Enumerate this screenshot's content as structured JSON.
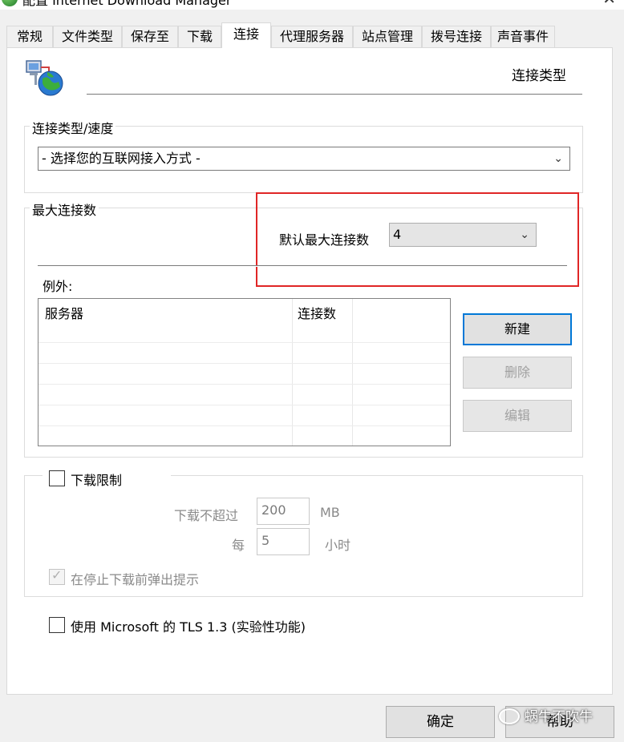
{
  "window": {
    "title": "配置 Internet Download Manager",
    "close_glyph": "✕"
  },
  "tabs": [
    {
      "label": "常规"
    },
    {
      "label": "文件类型"
    },
    {
      "label": "保存至"
    },
    {
      "label": "下载"
    },
    {
      "label": "连接",
      "active": true
    },
    {
      "label": "代理服务器"
    },
    {
      "label": "站点管理"
    },
    {
      "label": "拨号连接"
    },
    {
      "label": "声音事件"
    }
  ],
  "header": {
    "icon": "network-globe-icon",
    "title": "连接类型"
  },
  "connection_type": {
    "group_label": "连接类型/速度",
    "selected": "- 选择您的互联网接入方式 -"
  },
  "max_connections": {
    "group_label": "最大连接数",
    "default_label": "默认最大连接数",
    "default_value": "4",
    "exceptions_label": "例外:",
    "columns": [
      "服务器",
      "连接数"
    ],
    "rows": []
  },
  "buttons": {
    "new": "新建",
    "delete": "删除",
    "edit": "编辑"
  },
  "download_limit": {
    "checkbox_label": "下载限制",
    "checked": false,
    "max_label": "下载不超过",
    "max_value": "200",
    "max_unit": "MB",
    "per_label": "每",
    "per_value": "5",
    "per_unit": "小时",
    "prompt_label": "在停止下载前弹出提示",
    "prompt_checked": true
  },
  "tls": {
    "label": "使用 Microsoft 的 TLS 1.3 (实验性功能)",
    "checked": false
  },
  "footer": {
    "ok": "确定",
    "help": "帮助"
  },
  "watermark": {
    "text": "蜗牛不吹牛"
  },
  "colors": {
    "highlight_box": "#e02626",
    "primary_border": "#0078d7"
  }
}
